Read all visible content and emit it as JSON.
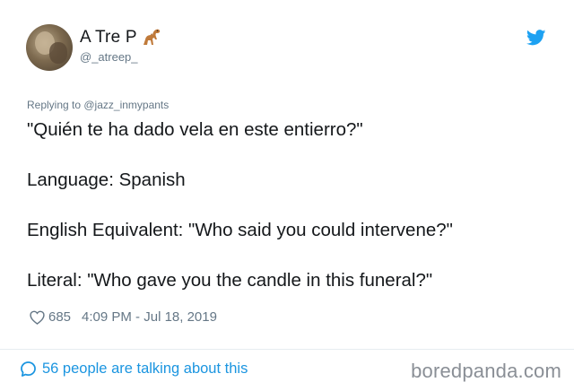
{
  "tweet": {
    "display_name": "A Tre P",
    "handle": "@_atreep_",
    "replying_to_prefix": "Replying to ",
    "replying_to_mention": "@jazz_inmypants",
    "lines": [
      "\"Quién te ha dado vela en este entierro?\"",
      "Language: Spanish",
      "English Equivalent: \"Who said you could intervene?\"",
      "Literal: \"Who gave you the candle in this funeral?\""
    ],
    "likes": "685",
    "timestamp": "4:09 PM - Jul 18, 2019",
    "talking": "56 people are talking about this"
  },
  "watermark": "boredpanda.com",
  "icons": {
    "avatar": "avatar-photo",
    "name_emoji": "dinosaur-icon",
    "platform": "twitter-bird-icon",
    "like": "heart-icon",
    "conversation": "speech-bubble-icon"
  },
  "colors": {
    "text": "#14171a",
    "muted": "#657786",
    "link": "#1b95e0",
    "bird": "#1da1f2",
    "watermark": "#8a8f96"
  }
}
